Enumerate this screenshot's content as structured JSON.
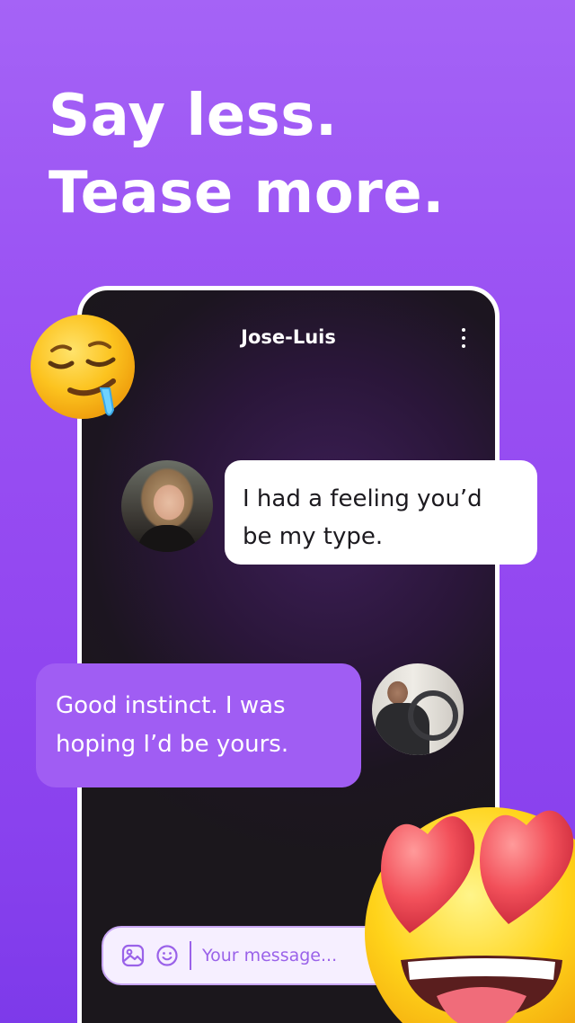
{
  "headline": {
    "line1": "Say less.",
    "line2": "Tease more."
  },
  "chat": {
    "contact_name": "Jose-Luis",
    "messages": [
      {
        "from": "her",
        "text_line1": "I had a feeling you’d",
        "text_line2": "be my type."
      },
      {
        "from": "him",
        "text_line1": "Good instinct. I was",
        "text_line2": "hoping I’d be yours."
      }
    ],
    "input_placeholder": "Your message..."
  },
  "icons": {
    "menu": "more-vertical-icon",
    "gallery": "image-gallery-icon",
    "emoji": "smiley-icon",
    "decor_top": "drooling-face-emoji",
    "decor_bottom": "heart-eyes-emoji"
  },
  "colors": {
    "background_top": "#a563f6",
    "background_bottom": "#7d3aea",
    "bubble_outgoing": "#a05df3",
    "bubble_incoming": "#ffffff",
    "accent": "#9a62e9"
  }
}
